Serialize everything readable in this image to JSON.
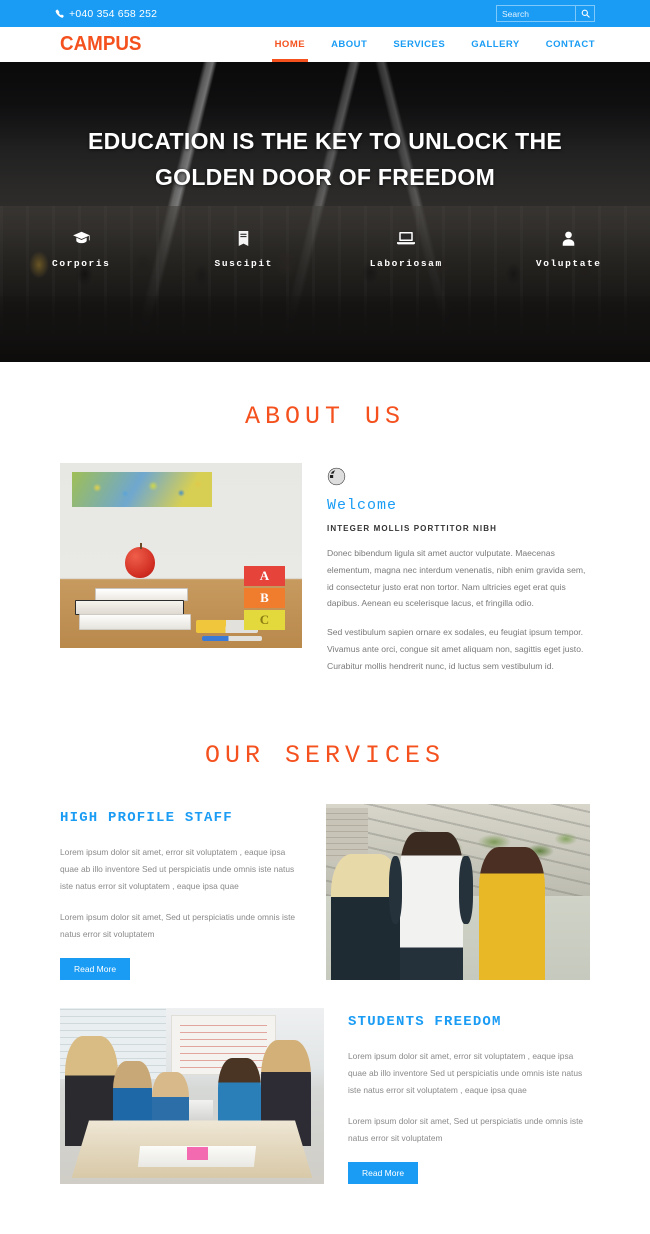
{
  "topbar": {
    "phone": "+040 354 658 252",
    "phone_icon": "phone-icon",
    "search_placeholder": "Search",
    "search_value": "",
    "search_icon": "search-icon"
  },
  "header": {
    "logo": "CAMPUS",
    "nav": [
      {
        "label": "HOME",
        "active": true
      },
      {
        "label": "ABOUT",
        "active": false
      },
      {
        "label": "SERVICES",
        "active": false
      },
      {
        "label": "GALLERY",
        "active": false
      },
      {
        "label": "CONTACT",
        "active": false
      }
    ]
  },
  "hero": {
    "title": "EDUCATION IS THE KEY TO UNLOCK THE GOLDEN DOOR OF FREEDOM",
    "features": [
      {
        "label": "Corporis",
        "icon": "graduation-cap-icon"
      },
      {
        "label": "Suscipit",
        "icon": "book-icon"
      },
      {
        "label": "Laboriosam",
        "icon": "laptop-icon"
      },
      {
        "label": "Voluptate",
        "icon": "user-icon"
      }
    ]
  },
  "about": {
    "section_title": "ABOUT US",
    "image_alt": "apple on stack of books with ABC blocks and pencils on a desk",
    "icon": "globe-icon",
    "heading": "Welcome",
    "subheading": "INTEGER MOLLIS PORTTITOR NIBH",
    "paragraph1": "Donec bibendum ligula sit amet auctor vulputate. Maecenas elementum, magna nec interdum venenatis, nibh enim gravida sem, id consectetur justo erat non tortor. Nam ultricies eget erat quis dapibus. Aenean eu scelerisque lacus, et fringilla odio.",
    "paragraph2": "Sed vestibulum sapien ornare ex sodales, eu feugiat ipsum tempor. Vivamus ante orci, congue sit amet aliquam non, sagittis eget justo. Curabitur mollis hendrerit nunc, id luctus sem vestibulum id."
  },
  "services": {
    "section_title": "OUR SERVICES",
    "items": [
      {
        "title": "HIGH PROFILE STAFF",
        "paragraph1": "Lorem ipsum dolor sit amet, error sit voluptatem , eaque ipsa quae ab illo inventore Sed ut perspiciatis unde omnis iste natus iste natus error sit voluptatem , eaque ipsa quae",
        "paragraph2": "Lorem ipsum dolor sit amet, Sed ut perspiciatis unde omnis iste natus error sit voluptatem",
        "button": "Read More",
        "image_alt": "three students talking outdoors on steps"
      },
      {
        "title": "STUDENTS FREEDOM",
        "paragraph1": "Lorem ipsum dolor sit amet, error sit voluptatem , eaque ipsa quae ab illo inventore Sed ut perspiciatis unde omnis iste natus iste natus error sit voluptatem , eaque ipsa quae",
        "paragraph2": "Lorem ipsum dolor sit amet, Sed ut perspiciatis unde omnis iste natus error sit voluptatem",
        "button": "Read More",
        "image_alt": "students collaborating around a table with laptops"
      }
    ]
  },
  "colors": {
    "accent_blue": "#1a9cf4",
    "accent_orange": "#f4511e",
    "body_text": "#7a7a7a"
  }
}
